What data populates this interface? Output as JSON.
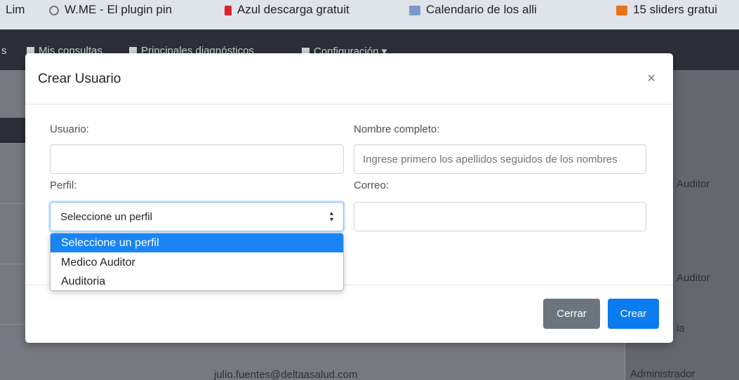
{
  "bookmarks": [
    {
      "label": "Lim",
      "icon": "bookmark-icon",
      "color": "#444"
    },
    {
      "label": "W.ME - El plugin pin",
      "icon": "whatsapp-icon",
      "color": "#777"
    },
    {
      "label": "Azul descarga gratuit",
      "icon": "azul-icon",
      "color": "#d9232e"
    },
    {
      "label": "Calendario de los alli",
      "icon": "calendar-icon",
      "color": "#7b9bc7"
    },
    {
      "label": "15 sliders gratui",
      "icon": "pen-icon",
      "color": "#e8731a"
    }
  ],
  "navbar": {
    "items": [
      {
        "label": "s"
      },
      {
        "label": "Mis consultas"
      },
      {
        "label": "Principales diagnósticos"
      },
      {
        "label": "Configuración ▾"
      }
    ]
  },
  "background_table": {
    "right_cells": [
      "Auditor",
      "Auditor",
      "ia",
      "Administrador"
    ],
    "email": "julio.fuentes@deltaasalud.com"
  },
  "modal": {
    "title": "Crear Usuario",
    "close_glyph": "×",
    "fields": {
      "usuario_label": "Usuario:",
      "usuario_value": "",
      "nombre_label": "Nombre completo:",
      "nombre_placeholder": "Ingrese primero los apellidos seguidos de los nombres",
      "perfil_label": "Perfil:",
      "perfil_selected": "Seleccione un perfil",
      "correo_label": "Correo:",
      "correo_value": ""
    },
    "buttons": {
      "close_label": "Cerrar",
      "create_label": "Crear"
    }
  },
  "dropdown": {
    "options": [
      "Seleccione un perfil",
      "Medico Auditor",
      "Auditoria"
    ],
    "selected_index": 0
  },
  "colors": {
    "primary": "#0b7bf0",
    "secondary": "#6c757d",
    "option_highlight": "#1a84f5"
  }
}
